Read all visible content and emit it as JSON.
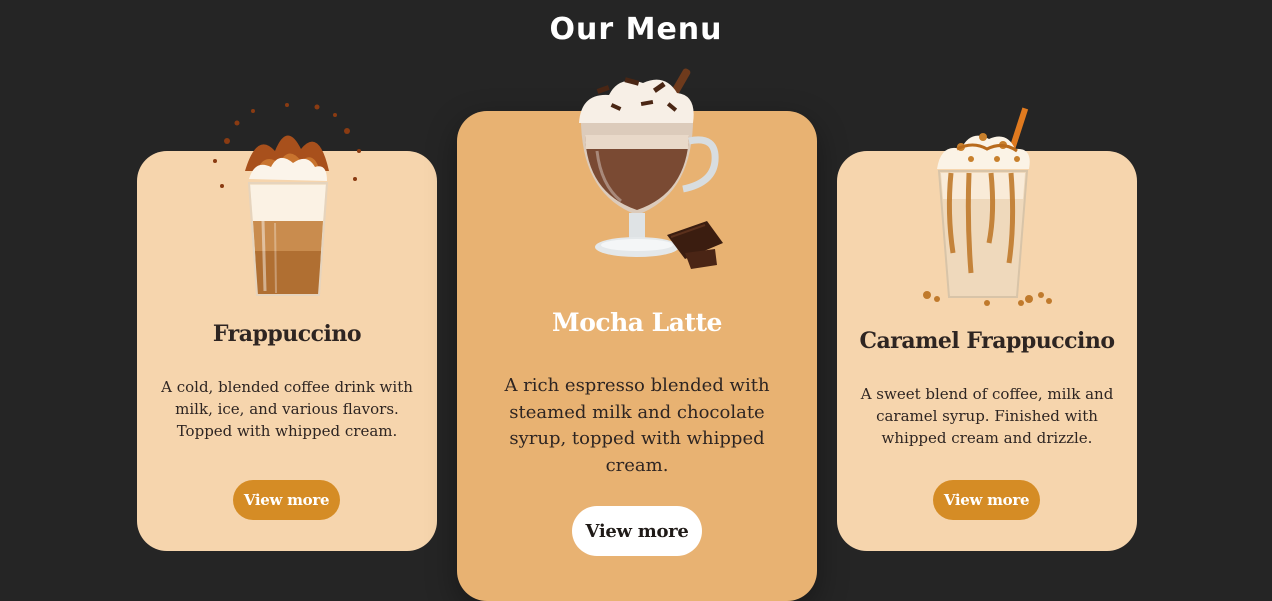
{
  "menu": {
    "title": "Our Menu",
    "items": [
      {
        "name": "Frappuccino",
        "description": "A cold, blended coffee drink with milk, ice, and various flavors. Topped with whipped cream.",
        "button_label": "View more"
      },
      {
        "name": "Mocha Latte",
        "description": "A rich espresso blended with steamed milk and chocolate syrup, topped with whipped cream.",
        "button_label": "View more"
      },
      {
        "name": "Caramel Frappuccino",
        "description": "A sweet blend of coffee, milk and caramel syrup. Finished with whipped cream and drizzle.",
        "button_label": "View more"
      }
    ]
  },
  "colors": {
    "page_background": "#252525",
    "card_light": "#f6d5ad",
    "card_featured": "#e8b272",
    "button_accent": "#d58c25",
    "text_dark": "#2e2522"
  }
}
